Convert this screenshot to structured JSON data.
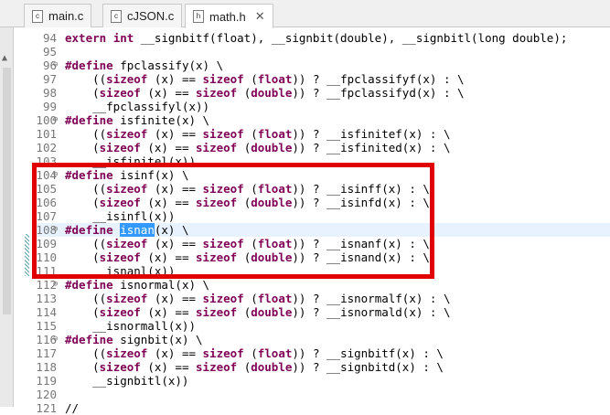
{
  "tabs": [
    {
      "label": "main.c",
      "icon": "c-file-icon",
      "active": false
    },
    {
      "label": "cJSON.c",
      "icon": "c-file-icon",
      "active": false
    },
    {
      "label": "math.h",
      "icon": "h-file-icon",
      "active": true,
      "close": "✕"
    }
  ],
  "colors": {
    "keyword": "#7f0055",
    "highlight": "#e00000",
    "selection": "#3399ff"
  },
  "lines": [
    {
      "n": "94",
      "segs": [
        [
          "kw",
          "extern"
        ],
        [
          "t",
          " "
        ],
        [
          "kw",
          "int"
        ],
        [
          "t",
          " __signbitf(float), __signbit(double), __signbitl(long double);"
        ]
      ]
    },
    {
      "n": "95",
      "segs": []
    },
    {
      "n": "96",
      "fold": true,
      "segs": [
        [
          "kw",
          "#define"
        ],
        [
          "t",
          " fpclassify(x) \\"
        ]
      ]
    },
    {
      "n": "97",
      "segs": [
        [
          "t",
          "    (("
        ],
        [
          "kw",
          "sizeof"
        ],
        [
          "t",
          " (x) == "
        ],
        [
          "kw",
          "sizeof"
        ],
        [
          "t",
          " ("
        ],
        [
          "kw",
          "float"
        ],
        [
          "t",
          ")) ? __fpclassifyf(x) : \\"
        ]
      ]
    },
    {
      "n": "98",
      "segs": [
        [
          "t",
          "    ("
        ],
        [
          "kw",
          "sizeof"
        ],
        [
          "t",
          " (x) == "
        ],
        [
          "kw",
          "sizeof"
        ],
        [
          "t",
          " ("
        ],
        [
          "kw",
          "double"
        ],
        [
          "t",
          ")) ? __fpclassifyd(x) : \\"
        ]
      ]
    },
    {
      "n": "99",
      "segs": [
        [
          "t",
          "    __fpclassifyl(x))"
        ]
      ]
    },
    {
      "n": "100",
      "fold": true,
      "segs": [
        [
          "kw",
          "#define"
        ],
        [
          "t",
          " isfinite(x) \\"
        ]
      ]
    },
    {
      "n": "101",
      "segs": [
        [
          "t",
          "    (("
        ],
        [
          "kw",
          "sizeof"
        ],
        [
          "t",
          " (x) == "
        ],
        [
          "kw",
          "sizeof"
        ],
        [
          "t",
          " ("
        ],
        [
          "kw",
          "float"
        ],
        [
          "t",
          ")) ? __isfinitef(x) : \\"
        ]
      ]
    },
    {
      "n": "102",
      "segs": [
        [
          "t",
          "    ("
        ],
        [
          "kw",
          "sizeof"
        ],
        [
          "t",
          " (x) == "
        ],
        [
          "kw",
          "sizeof"
        ],
        [
          "t",
          " ("
        ],
        [
          "kw",
          "double"
        ],
        [
          "t",
          ")) ? __isfinited(x) : \\"
        ]
      ]
    },
    {
      "n": "103",
      "segs": [
        [
          "t",
          "    __isfinitel(x))"
        ]
      ]
    },
    {
      "n": "104",
      "fold": true,
      "segs": [
        [
          "kw",
          "#define"
        ],
        [
          "t",
          " isinf(x) \\"
        ]
      ]
    },
    {
      "n": "105",
      "segs": [
        [
          "t",
          "    (("
        ],
        [
          "kw",
          "sizeof"
        ],
        [
          "t",
          " (x) == "
        ],
        [
          "kw",
          "sizeof"
        ],
        [
          "t",
          " ("
        ],
        [
          "kw",
          "float"
        ],
        [
          "t",
          ")) ? __isinff(x) : \\"
        ]
      ]
    },
    {
      "n": "106",
      "segs": [
        [
          "t",
          "    ("
        ],
        [
          "kw",
          "sizeof"
        ],
        [
          "t",
          " (x) == "
        ],
        [
          "kw",
          "sizeof"
        ],
        [
          "t",
          " ("
        ],
        [
          "kw",
          "double"
        ],
        [
          "t",
          ")) ? __isinfd(x) : \\"
        ]
      ]
    },
    {
      "n": "107",
      "segs": [
        [
          "t",
          "    __isinfl(x))"
        ]
      ]
    },
    {
      "n": "108",
      "fold": true,
      "current": true,
      "segs": [
        [
          "kw",
          "#define"
        ],
        [
          "t",
          " "
        ],
        [
          "sel",
          "isnan"
        ],
        [
          "t",
          "(x) \\"
        ]
      ]
    },
    {
      "n": "109",
      "segs": [
        [
          "t",
          "    (("
        ],
        [
          "kw",
          "sizeof"
        ],
        [
          "t",
          " (x) == "
        ],
        [
          "kw",
          "sizeof"
        ],
        [
          "t",
          " ("
        ],
        [
          "kw",
          "float"
        ],
        [
          "t",
          ")) ? __isnanf(x) : \\"
        ]
      ]
    },
    {
      "n": "110",
      "segs": [
        [
          "t",
          "    ("
        ],
        [
          "kw",
          "sizeof"
        ],
        [
          "t",
          " (x) == "
        ],
        [
          "kw",
          "sizeof"
        ],
        [
          "t",
          " ("
        ],
        [
          "kw",
          "double"
        ],
        [
          "t",
          ")) ? __isnand(x) : \\"
        ]
      ]
    },
    {
      "n": "111",
      "segs": [
        [
          "t",
          "    __isnanl(x))"
        ]
      ]
    },
    {
      "n": "112",
      "fold": true,
      "segs": [
        [
          "kw",
          "#define"
        ],
        [
          "t",
          " isnormal(x) \\"
        ]
      ]
    },
    {
      "n": "113",
      "segs": [
        [
          "t",
          "    (("
        ],
        [
          "kw",
          "sizeof"
        ],
        [
          "t",
          " (x) == "
        ],
        [
          "kw",
          "sizeof"
        ],
        [
          "t",
          " ("
        ],
        [
          "kw",
          "float"
        ],
        [
          "t",
          ")) ? __isnormalf(x) : \\"
        ]
      ]
    },
    {
      "n": "114",
      "segs": [
        [
          "t",
          "    ("
        ],
        [
          "kw",
          "sizeof"
        ],
        [
          "t",
          " (x) == "
        ],
        [
          "kw",
          "sizeof"
        ],
        [
          "t",
          " ("
        ],
        [
          "kw",
          "double"
        ],
        [
          "t",
          ")) ? __isnormald(x) : \\"
        ]
      ]
    },
    {
      "n": "115",
      "segs": [
        [
          "t",
          "    __isnormall(x))"
        ]
      ]
    },
    {
      "n": "116",
      "fold": true,
      "segs": [
        [
          "kw",
          "#define"
        ],
        [
          "t",
          " signbit(x) \\"
        ]
      ]
    },
    {
      "n": "117",
      "segs": [
        [
          "t",
          "    (("
        ],
        [
          "kw",
          "sizeof"
        ],
        [
          "t",
          " (x) == "
        ],
        [
          "kw",
          "sizeof"
        ],
        [
          "t",
          " ("
        ],
        [
          "kw",
          "float"
        ],
        [
          "t",
          ")) ? __signbitf(x) : \\"
        ]
      ]
    },
    {
      "n": "118",
      "segs": [
        [
          "t",
          "    ("
        ],
        [
          "kw",
          "sizeof"
        ],
        [
          "t",
          " (x) == "
        ],
        [
          "kw",
          "sizeof"
        ],
        [
          "t",
          " ("
        ],
        [
          "kw",
          "double"
        ],
        [
          "t",
          ")) ? __signbitd(x) : \\"
        ]
      ]
    },
    {
      "n": "119",
      "segs": [
        [
          "t",
          "    __signbitl(x))"
        ]
      ]
    },
    {
      "n": "120",
      "segs": []
    },
    {
      "n": "121",
      "segs": [
        [
          "t",
          "//"
        ]
      ]
    }
  ]
}
